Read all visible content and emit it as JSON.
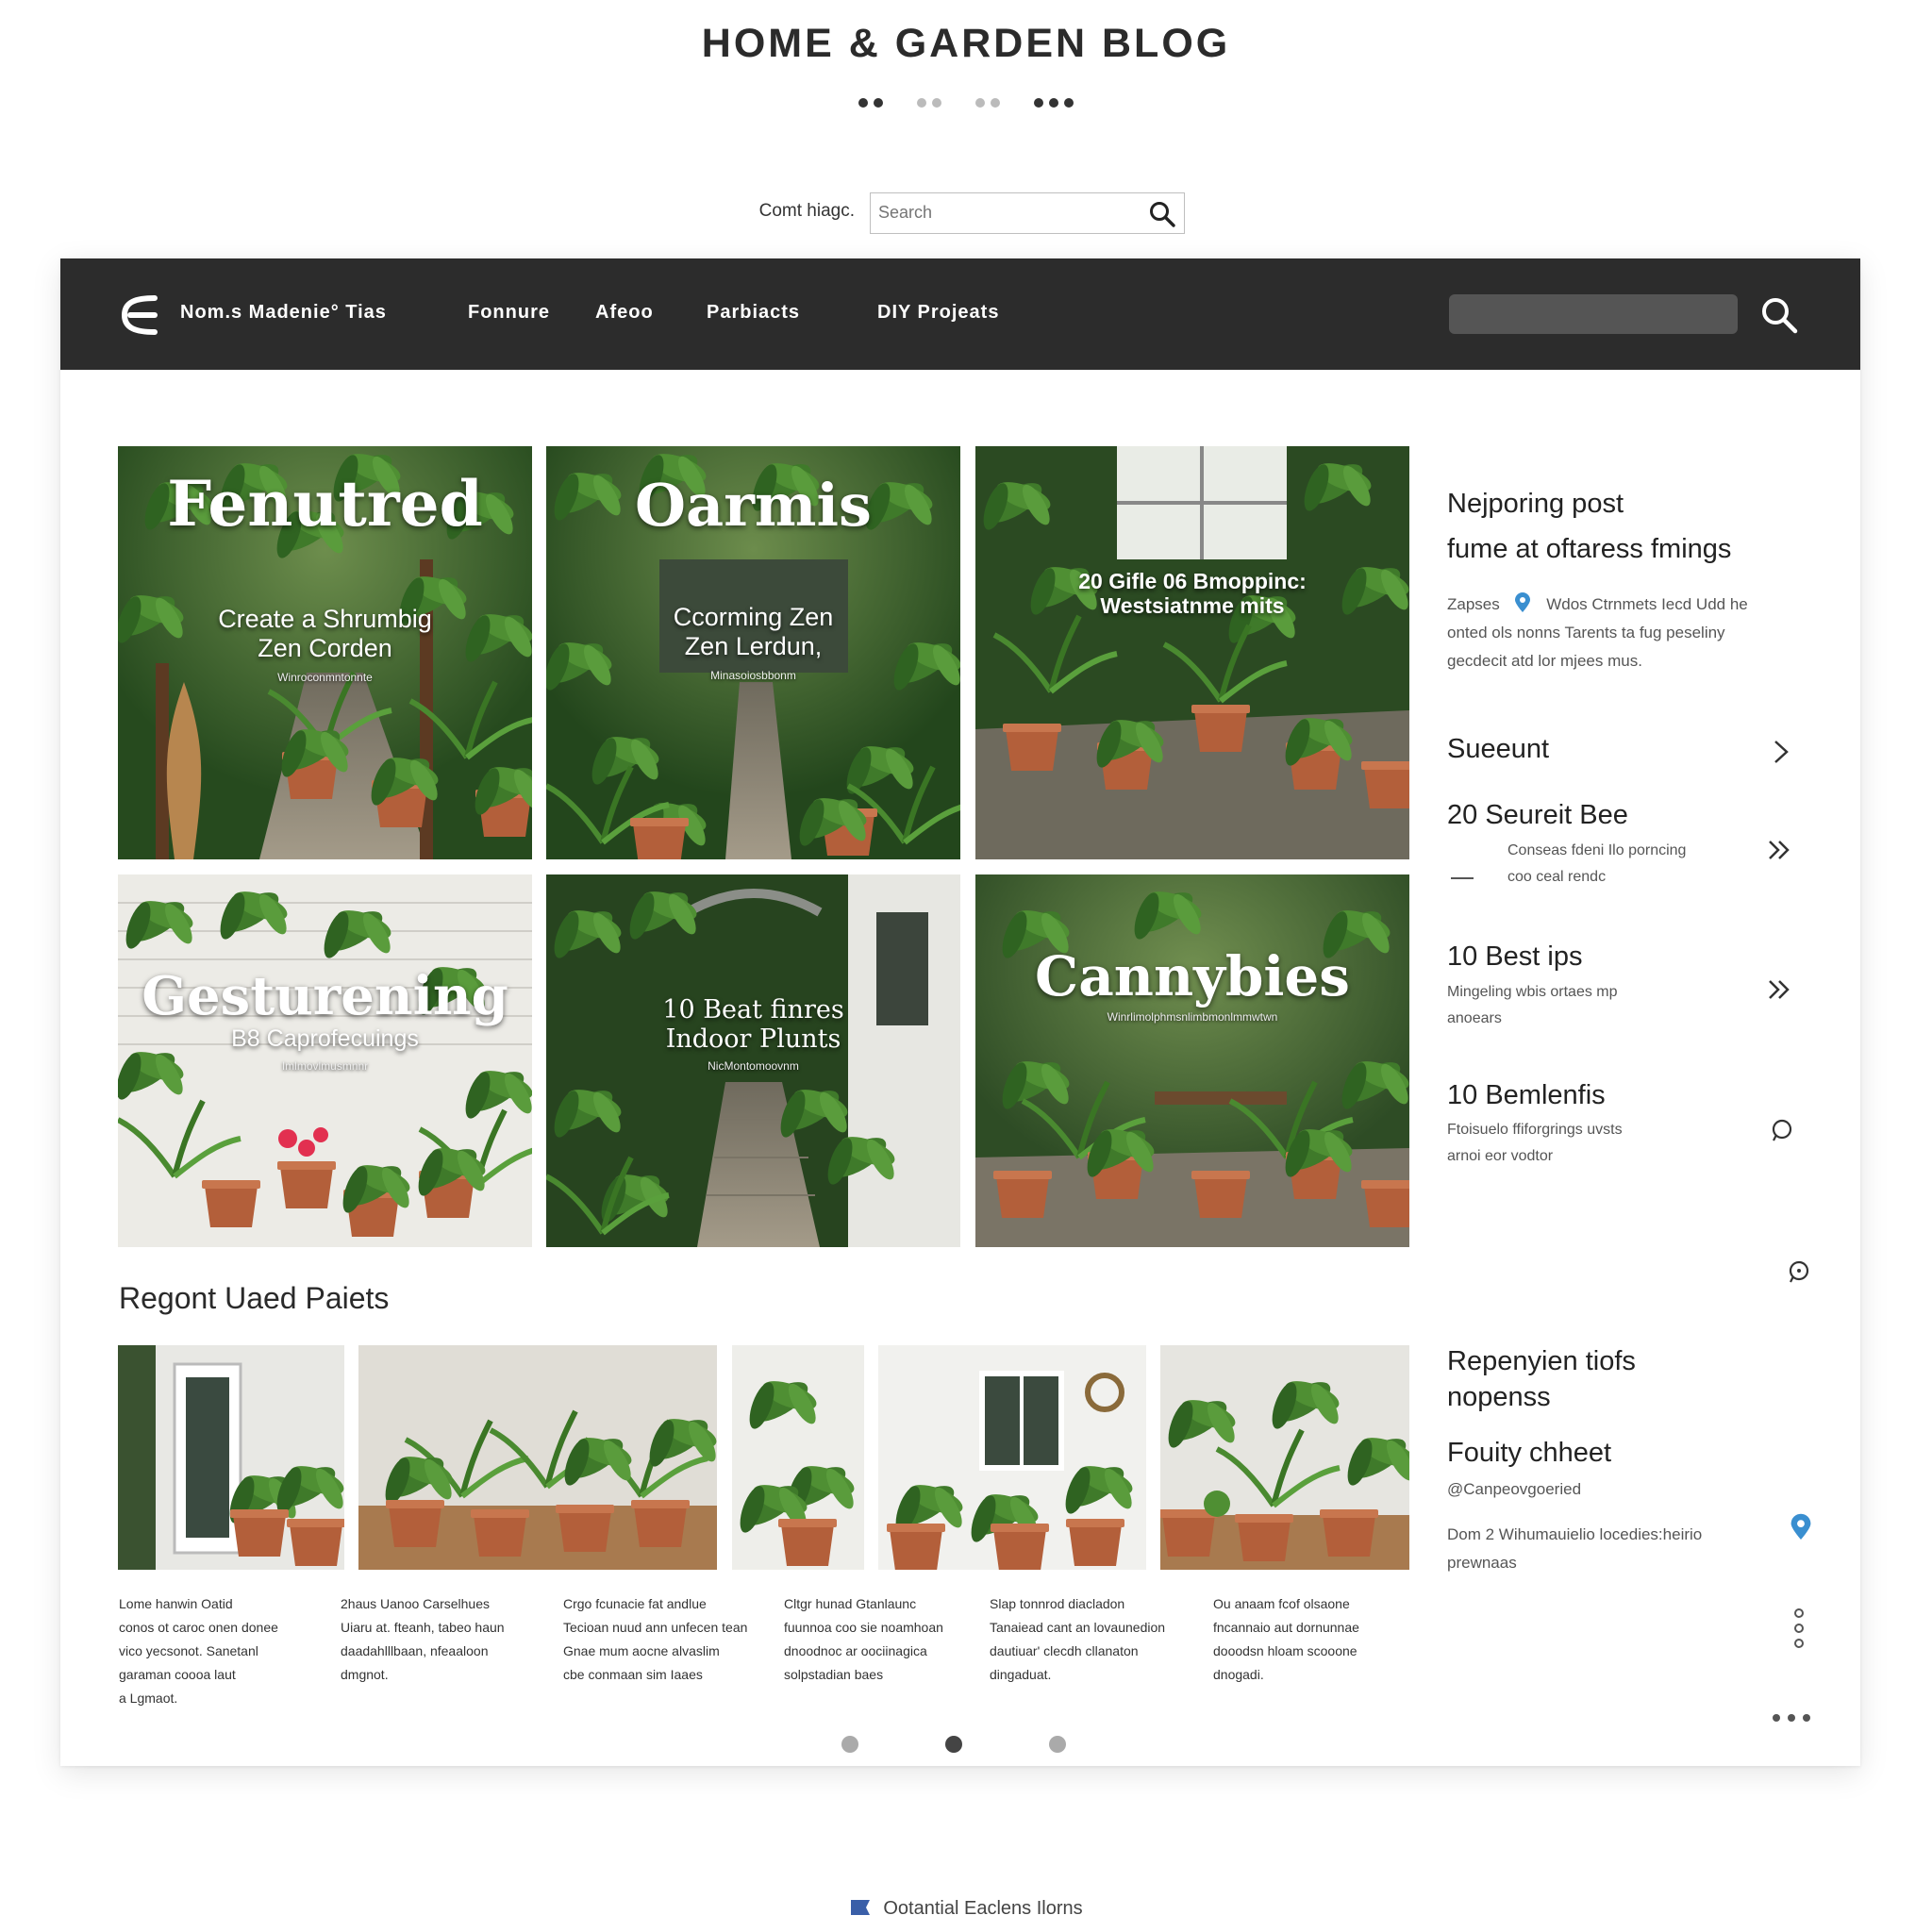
{
  "site": {
    "title": "HOME & GARDEN BLOG",
    "search_label": "Comt hiagc.",
    "search_placeholder": "Search",
    "search_value": "Search"
  },
  "nav": {
    "brand": "Nom.s Madenie° Tias",
    "items": [
      "Fonnure",
      "Afeoo",
      "Parbiacts",
      "DIY Projeats"
    ]
  },
  "features": [
    {
      "title": "Fenutred",
      "subtitle_line1": "Create a Shrumbig",
      "subtitle_line2": "Zen Corden",
      "caption": "Winroconmntonnte"
    },
    {
      "title": "Oarmis",
      "subtitle_line1": "Ccorming Zen",
      "subtitle_line2": "Zen Lerdun,",
      "caption": "Minasoiosbbonm"
    },
    {
      "title": "",
      "subtitle_line1": "20 Gifle 06 Bmoppinc:",
      "subtitle_line2": "Westsiatnme mits",
      "caption": ""
    },
    {
      "title": "Gesturening",
      "subtitle_line1": "B8 Caprofecuings",
      "subtitle_line2": "",
      "caption": "Imlmovlmusmnnr"
    },
    {
      "title": "",
      "subtitle_line1": "10 Beat finres",
      "subtitle_line2": "Indoor Plunts",
      "caption": "NicMontomoovnm"
    },
    {
      "title": "Cannybies",
      "subtitle_line1": "",
      "subtitle_line2": "",
      "caption": "Winrlimolphmsnlimbmonlmmwtwn"
    }
  ],
  "sidebar": {
    "popular_heading_line1": "Nejporing post",
    "popular_heading_line2": "fume at oftaress fmings",
    "popular_meta": "Zapses",
    "popular_text_line1": "Wdos Ctrnmets Iecd Udd he",
    "popular_text_line2": "onted ols nonns Tarents ta fug peseliny",
    "popular_text_line3": "gecdecit atd lor mjees mus.",
    "list": [
      {
        "heading": "Sueeunt",
        "text_line1": "",
        "text_line2": ""
      },
      {
        "heading": "20 Seureit Bee",
        "text_line1": "Conseas fdeni Ilo porncing",
        "text_line2": "coo ceal rendc"
      },
      {
        "heading": "10 Best ips",
        "text_line1": "Mingeling wbis ortaes mp",
        "text_line2": "anoears"
      },
      {
        "heading": "10 Bemlenfis",
        "text_line1": "Ftoisuelo ffiforgrings uvsts",
        "text_line2": "arnoi eor vodtor"
      }
    ],
    "bottom_heading_line1": "Repenyien tiofs",
    "bottom_heading_line2": "nopenss",
    "bottom_sub_heading": "Fouity chheet",
    "bottom_handle": "@Canpeovgoeried",
    "bottom_text_line1": "Dom  2  Wihumauielio locedies:heirio",
    "bottom_text_line2": "prewnaas"
  },
  "recent": {
    "heading": "Regont Uaed Paiets",
    "items": [
      {
        "l1": "Lome hanwin Oatid",
        "l2": "conos ot caroc onen donee",
        "l3": "vico yecsonot. Sanetanl",
        "l4": "garaman coooa laut",
        "l5": "a Lgmaot."
      },
      {
        "l1": "2haus Uanoo Carselhues",
        "l2": "Uiaru at. fteanh, tabeo haun",
        "l3": "daadahlllbaan, nfeaaloon",
        "l4": "dmgnot.",
        "l5": ""
      },
      {
        "l1": "Crgo fcunacie fat andlue",
        "l2": "Tecioan nuud ann unfecen tean",
        "l3": "Gnae mum aocne alvaslim",
        "l4": "cbe conmaan sim Iaaes",
        "l5": ""
      },
      {
        "l1": "Cltgr hunad Gtanlaunc",
        "l2": "fuunnoa coo sie noamhoan",
        "l3": "dnoodnoc ar oociinagica",
        "l4": "solpstadian baes",
        "l5": ""
      },
      {
        "l1": "Slap tonnrod diacladon",
        "l2": "Tanaiead cant an lovaunedion",
        "l3": "dautiuar' clecdh cllanaton",
        "l4": "dingaduat.",
        "l5": ""
      },
      {
        "l1": "Ou anaam fcof olsaone",
        "l2": "fncannaio aut dornunnae",
        "l3": "dooodsn hloam scooone",
        "l4": "dnogadi.",
        "l5": ""
      }
    ]
  },
  "footer": {
    "link": "Ootantial Eaclens Ilorns"
  },
  "colors": {
    "navbar": "#2c2c2c",
    "accent_pin": "#3a8fd0",
    "foliage": "#2f5a25",
    "pot": "#b35f3a"
  }
}
